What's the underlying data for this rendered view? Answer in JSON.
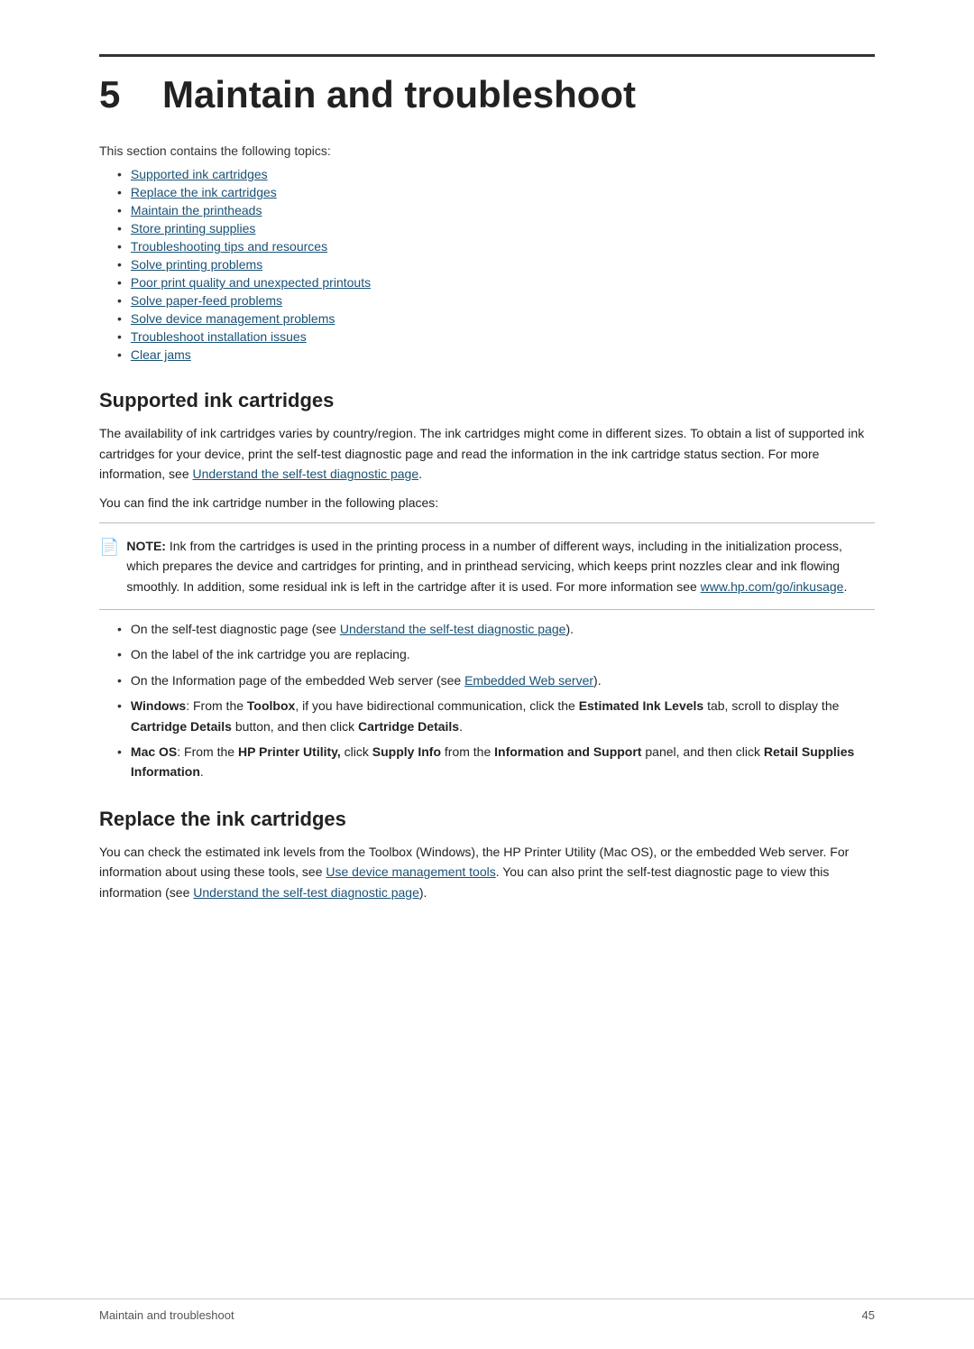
{
  "chapter": {
    "number": "5",
    "title": "Maintain and troubleshoot",
    "intro": "This section contains the following topics:"
  },
  "toc": {
    "items": [
      {
        "label": "Supported ink cartridges",
        "href": "#supported-ink-cartridges"
      },
      {
        "label": "Replace the ink cartridges",
        "href": "#replace-ink-cartridges"
      },
      {
        "label": "Maintain the printheads",
        "href": "#maintain-printheads"
      },
      {
        "label": "Store printing supplies",
        "href": "#store-printing-supplies"
      },
      {
        "label": "Troubleshooting tips and resources",
        "href": "#troubleshooting-tips"
      },
      {
        "label": "Solve printing problems",
        "href": "#solve-printing-problems"
      },
      {
        "label": "Poor print quality and unexpected printouts",
        "href": "#poor-print-quality"
      },
      {
        "label": "Solve paper-feed problems",
        "href": "#solve-paper-feed"
      },
      {
        "label": "Solve device management problems",
        "href": "#solve-device-management"
      },
      {
        "label": "Troubleshoot installation issues",
        "href": "#troubleshoot-installation"
      },
      {
        "label": "Clear jams",
        "href": "#clear-jams"
      }
    ]
  },
  "sections": {
    "supported_ink_cartridges": {
      "heading": "Supported ink cartridges",
      "para1": "The availability of ink cartridges varies by country/region. The ink cartridges might come in different sizes. To obtain a list of supported ink cartridges for your device, print the self-test diagnostic page and read the information in the ink cartridge status section. For more information, see ",
      "para1_link": "Understand the self-test diagnostic page",
      "para1_end": ".",
      "para2": "You can find the ink cartridge number in the following places:",
      "note_label": "NOTE:",
      "note_text": " Ink from the cartridges is used in the printing process in a number of different ways, including in the initialization process, which prepares the device and cartridges for printing, and in printhead servicing, which keeps print nozzles clear and ink flowing smoothly. In addition, some residual ink is left in the cartridge after it is used. For more information see ",
      "note_link": "www.hp.com/go/inkusage",
      "note_end": ".",
      "bullets": [
        {
          "text": "On the self-test diagnostic page (see ",
          "link": "Understand the self-test diagnostic page",
          "end": ")."
        },
        {
          "text": "On the label of the ink cartridge you are replacing.",
          "link": null,
          "end": ""
        },
        {
          "text": "On the Information page of the embedded Web server (see ",
          "link": "Embedded Web server",
          "end": ")."
        },
        {
          "text_parts": [
            {
              "text": "",
              "bold": false
            },
            {
              "text": "Windows",
              "bold": true
            },
            {
              "text": ": From the ",
              "bold": false
            },
            {
              "text": "Toolbox",
              "bold": true
            },
            {
              "text": ", if you have bidirectional communication, click the ",
              "bold": false
            },
            {
              "text": "Estimated Ink Levels",
              "bold": true
            },
            {
              "text": " tab, scroll to display the ",
              "bold": false
            },
            {
              "text": "Cartridge Details",
              "bold": true
            },
            {
              "text": " button, and then click ",
              "bold": false
            },
            {
              "text": "Cartridge Details",
              "bold": true
            },
            {
              "text": ".",
              "bold": false
            }
          ]
        },
        {
          "text_parts": [
            {
              "text": "",
              "bold": false
            },
            {
              "text": "Mac OS",
              "bold": true
            },
            {
              "text": ": From the ",
              "bold": false
            },
            {
              "text": "HP Printer Utility,",
              "bold": true
            },
            {
              "text": " click ",
              "bold": false
            },
            {
              "text": "Supply Info",
              "bold": true
            },
            {
              "text": " from the ",
              "bold": false
            },
            {
              "text": "Information and Support",
              "bold": true
            },
            {
              "text": " panel, and then click ",
              "bold": false
            },
            {
              "text": "Retail Supplies Information",
              "bold": true
            },
            {
              "text": ".",
              "bold": false
            }
          ]
        }
      ]
    },
    "replace_ink_cartridges": {
      "heading": "Replace the ink cartridges",
      "para1": "You can check the estimated ink levels from the Toolbox (Windows), the HP Printer Utility (Mac OS), or the embedded Web server. For information about using these tools, see ",
      "para1_link": "Use device management tools",
      "para1_mid": ". You can also print the self-test diagnostic page to view this information (see ",
      "para1_link2": "Understand the self-test diagnostic page",
      "para1_end": ")."
    }
  },
  "footer": {
    "left": "Maintain and troubleshoot",
    "right": "45"
  }
}
